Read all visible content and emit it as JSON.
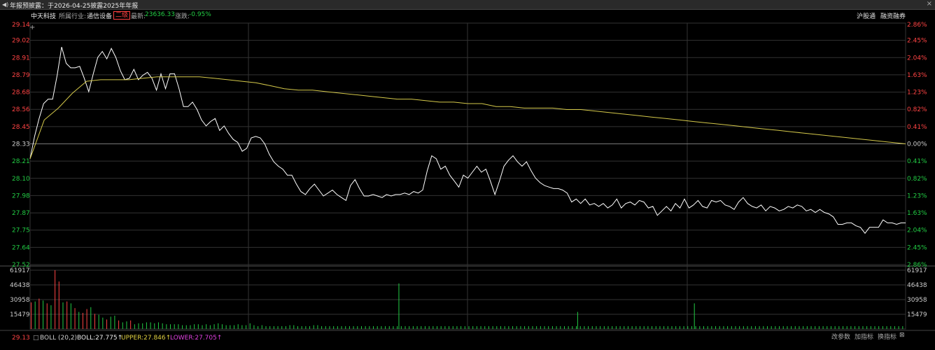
{
  "top_bar": {
    "announcement": "年报预披露：于2026-04-25披露2025年年报",
    "speaker_icon": "speaker-icon",
    "close_icon": "close-icon"
  },
  "info_bar": {
    "stock_name": "中天科技",
    "industry_label": "所属行业:",
    "industry": "通信设备",
    "rank_badge": "二级",
    "latest_label": "最新:",
    "latest_value": "23636.33",
    "change_label": "涨跌:",
    "change_value": "-0.95%",
    "link_hgt": "沪股通",
    "link_margin": "融资融券"
  },
  "colors": {
    "up": "#ff4444",
    "down": "#22cc44",
    "price_line": "#ffffff",
    "avg_line": "#d4c84a",
    "grid": "#333333",
    "ref_line": "#777777"
  },
  "chart_data": [
    {
      "type": "line",
      "title": "",
      "y_ticks": [
        "29.14",
        "29.02",
        "28.91",
        "28.79",
        "28.68",
        "28.56",
        "28.45",
        "28.33",
        "28.21",
        "28.10",
        "27.98",
        "27.87",
        "27.75",
        "27.64",
        "27.52"
      ],
      "pct_ticks": [
        "2.86%",
        "2.45%",
        "2.04%",
        "1.63%",
        "1.23%",
        "0.82%",
        "0.41%",
        "0.00%",
        "0.41%",
        "0.82%",
        "1.23%",
        "1.63%",
        "2.04%",
        "2.45%",
        "2.86%"
      ],
      "ylim": [
        27.52,
        29.14
      ],
      "reference_price": 28.33,
      "grid": true,
      "series": [
        {
          "role": "price",
          "values": [
            28.23,
            28.38,
            28.5,
            28.6,
            28.63,
            28.63,
            28.79,
            28.98,
            28.87,
            28.84,
            28.84,
            28.85,
            28.77,
            28.68,
            28.8,
            28.91,
            28.95,
            28.9,
            28.97,
            28.91,
            28.82,
            28.76,
            28.77,
            28.83,
            28.76,
            28.79,
            28.81,
            28.77,
            28.69,
            28.8,
            28.7,
            28.8,
            28.8,
            28.7,
            28.58,
            28.58,
            28.61,
            28.56,
            28.49,
            28.45,
            28.48,
            28.5,
            28.42,
            28.45,
            28.4,
            28.36,
            28.34,
            28.28,
            28.3,
            28.37,
            28.38,
            28.37,
            28.33,
            28.26,
            28.21,
            28.18,
            28.16,
            28.12,
            28.12,
            28.06,
            28.01,
            27.99,
            28.03,
            28.06,
            28.02,
            27.98,
            28.0,
            28.02,
            27.99,
            27.97,
            27.95,
            28.05,
            28.09,
            28.03,
            27.98,
            27.98,
            27.99,
            27.98,
            27.97,
            27.99,
            27.98,
            27.99,
            27.99,
            28.0,
            27.99,
            28.01,
            28.0,
            28.02,
            28.15,
            28.25,
            28.23,
            28.16,
            28.18,
            28.12,
            28.08,
            28.04,
            28.12,
            28.1,
            28.14,
            28.18,
            28.14,
            28.16,
            28.08,
            27.99,
            28.08,
            28.18,
            28.22,
            28.25,
            28.21,
            28.18,
            28.21,
            28.15,
            28.1,
            28.07,
            28.05,
            28.04,
            28.03,
            28.03,
            28.02,
            28.0,
            27.94,
            27.96,
            27.93,
            27.96,
            27.92,
            27.93,
            27.91,
            27.93,
            27.9,
            27.92,
            27.96,
            27.9,
            27.93,
            27.94,
            27.92,
            27.95,
            27.94,
            27.9,
            27.91,
            27.85,
            27.88,
            27.91,
            27.88,
            27.93,
            27.9,
            27.96,
            27.9,
            27.92,
            27.95,
            27.91,
            27.9,
            27.95,
            27.94,
            27.95,
            27.92,
            27.91,
            27.89,
            27.94,
            27.97,
            27.93,
            27.91,
            27.9,
            27.92,
            27.88,
            27.91,
            27.9,
            27.88,
            27.89,
            27.91,
            27.9,
            27.92,
            27.91,
            27.88,
            27.89,
            27.87,
            27.89,
            27.87,
            27.86,
            27.84,
            27.79,
            27.79,
            27.8,
            27.8,
            27.78,
            27.77,
            27.73,
            27.77,
            27.77,
            27.77,
            27.82,
            27.8,
            27.8,
            27.79,
            27.8,
            27.8
          ]
        },
        {
          "role": "average",
          "values": [
            28.23,
            28.49,
            28.57,
            28.67,
            28.75,
            28.76,
            28.76,
            28.76,
            28.77,
            28.78,
            28.78,
            28.78,
            28.78,
            28.77,
            28.76,
            28.75,
            28.74,
            28.72,
            28.7,
            28.69,
            28.69,
            28.68,
            28.67,
            28.66,
            28.65,
            28.64,
            28.63,
            28.63,
            28.62,
            28.61,
            28.61,
            28.6,
            28.6,
            28.58,
            28.58,
            28.57,
            28.57,
            28.57,
            28.56,
            28.56,
            28.55,
            28.54,
            28.53,
            28.52,
            28.51,
            28.5,
            28.49,
            28.48,
            28.47,
            28.46,
            28.45,
            28.44,
            28.43,
            28.42,
            28.41,
            28.4,
            28.39,
            28.38,
            28.37,
            28.36,
            28.35,
            28.34,
            28.33
          ]
        }
      ]
    },
    {
      "type": "bar",
      "title": "",
      "y_ticks": [
        "61917",
        "46438",
        "30958",
        "15479"
      ],
      "ylim": [
        0,
        61917
      ],
      "values": [
        28000,
        29000,
        32000,
        30000,
        27000,
        25000,
        61917,
        50000,
        28000,
        29000,
        27000,
        22000,
        18000,
        17000,
        21000,
        23000,
        16000,
        15000,
        12000,
        10000,
        13000,
        14000,
        9000,
        7000,
        8000,
        9000,
        5000,
        6000,
        6000,
        7000,
        7000,
        6000,
        7000,
        6000,
        5000,
        5000,
        5000,
        5000,
        4000,
        4000,
        4000,
        5000,
        5000,
        4000,
        5000,
        4000,
        5000,
        6000,
        5000,
        4000,
        4000,
        4000,
        5000,
        4000,
        4000,
        6000,
        4000,
        3000,
        4000,
        3000,
        3000,
        3000,
        3000,
        3000,
        3000,
        4000,
        4000,
        3000,
        3000,
        3000,
        3000,
        4000,
        4000,
        3000,
        3000,
        3000,
        3000,
        3000,
        3000,
        3000,
        3000,
        3000,
        3000,
        3000,
        3000,
        3000,
        3000,
        3000,
        3000,
        3000,
        3000,
        3000,
        3000,
        3000,
        3000,
        3000,
        3000,
        3000,
        3000,
        3000,
        3000,
        3000,
        3000,
        3000,
        3000,
        3000,
        3000,
        3000,
        3000,
        3000,
        3000,
        3000,
        3000,
        3000,
        3000,
        3000,
        3000,
        3000,
        3000,
        3000,
        3000,
        3000,
        3000,
        3000,
        3000,
        3000,
        3000,
        3000,
        3000,
        3000,
        3000,
        3000,
        3000,
        3000,
        3000,
        3000,
        3000,
        3000,
        3000,
        3000,
        3000,
        3000,
        3000,
        3000,
        3000,
        3000,
        3000,
        3000,
        3000,
        3000,
        3000,
        3000,
        3000,
        3000,
        3000,
        3000,
        3000,
        3000,
        3000,
        3000,
        3000,
        3000,
        3000,
        3000,
        3000,
        3000,
        3000,
        3000,
        3000,
        3000,
        3000,
        3000,
        3000,
        3000,
        3000,
        3000,
        3000,
        3000,
        3000,
        3000,
        3000,
        3000,
        3000,
        3000,
        3000,
        3000,
        3000,
        3000,
        3000,
        3000,
        3000,
        3000,
        3000,
        3000,
        3000,
        3000,
        3000,
        3000,
        3000,
        3000,
        3000,
        3000,
        3000,
        3000,
        3000,
        3000,
        3000,
        3000,
        3000,
        3000,
        3000,
        3000,
        3000,
        3000,
        3000,
        3000,
        3000,
        3000,
        3000,
        3000
      ],
      "colors": [
        "up",
        "down",
        "up",
        "down",
        "up",
        "down",
        "up",
        "up",
        "down",
        "up",
        "down",
        "up",
        "down",
        "up",
        "up",
        "down",
        "up",
        "down",
        "down",
        "up",
        "down",
        "down",
        "up",
        "down",
        "down",
        "up",
        "down",
        "down",
        "down",
        "down",
        "down",
        "down",
        "down",
        "down",
        "down",
        "down",
        "down",
        "down",
        "down",
        "down",
        "down",
        "down",
        "down",
        "down",
        "down",
        "down",
        "down",
        "down",
        "down",
        "down",
        "down",
        "down",
        "down",
        "down",
        "down",
        "down",
        "down",
        "down",
        "down",
        "down",
        "down",
        "down",
        "down",
        "down",
        "down",
        "down",
        "down",
        "down",
        "down",
        "down",
        "down",
        "down",
        "down",
        "down",
        "down",
        "down",
        "down",
        "down",
        "down",
        "down",
        "down",
        "down",
        "down",
        "down",
        "down",
        "down",
        "down",
        "down",
        "down",
        "down",
        "down",
        "down",
        "down",
        "down",
        "down",
        "down",
        "down",
        "down",
        "down",
        "down",
        "down",
        "down",
        "down",
        "down",
        "down",
        "down",
        "down",
        "down",
        "down",
        "down",
        "down",
        "down",
        "down",
        "down",
        "down",
        "down",
        "down",
        "down",
        "down",
        "down",
        "down",
        "down",
        "down",
        "down",
        "down",
        "down",
        "down",
        "down",
        "down",
        "down",
        "down",
        "down",
        "down",
        "down",
        "down",
        "down",
        "down",
        "down",
        "down",
        "down",
        "down",
        "down",
        "down",
        "down",
        "down",
        "down",
        "down",
        "down",
        "down",
        "down",
        "down",
        "down",
        "down",
        "down",
        "down",
        "down",
        "down",
        "down",
        "down",
        "down",
        "down",
        "down",
        "down",
        "down",
        "down",
        "down",
        "down",
        "down",
        "down",
        "down",
        "down",
        "down",
        "down",
        "down",
        "down",
        "down",
        "down",
        "down",
        "down",
        "down",
        "down",
        "down",
        "down",
        "down",
        "down",
        "down",
        "down",
        "down",
        "down",
        "down",
        "down",
        "down",
        "down",
        "down",
        "down",
        "down",
        "down",
        "down",
        "down",
        "down",
        "down",
        "down",
        "down",
        "down",
        "down",
        "down",
        "down",
        "down",
        "down",
        "down",
        "down",
        "down",
        "down",
        "down",
        "down",
        "down",
        "down",
        "down",
        "down",
        "down",
        "down",
        "down",
        "down",
        "down",
        "down",
        "down",
        "down",
        "down",
        "down",
        "down",
        "down",
        "down",
        "down",
        "down",
        "down",
        "down",
        "down",
        "down",
        "down",
        "down",
        "down",
        "down"
      ],
      "highlights": [
        {
          "index": 101,
          "value": 48000,
          "color": "down"
        },
        {
          "index": 150,
          "value": 18000,
          "color": "down"
        },
        {
          "index": 182,
          "value": 27000,
          "color": "down"
        }
      ]
    }
  ],
  "indicator": {
    "price_tick": "29.13",
    "name": "BOLL (20,2)",
    "boll": "BOLL:27.775↑",
    "upper": "UPPER:27.846↑",
    "lower": "LOWER:27.705↑"
  },
  "toolbar": {
    "change_params": "改参数",
    "add_indicator": "加指标",
    "switch_indicator": "换指标"
  }
}
